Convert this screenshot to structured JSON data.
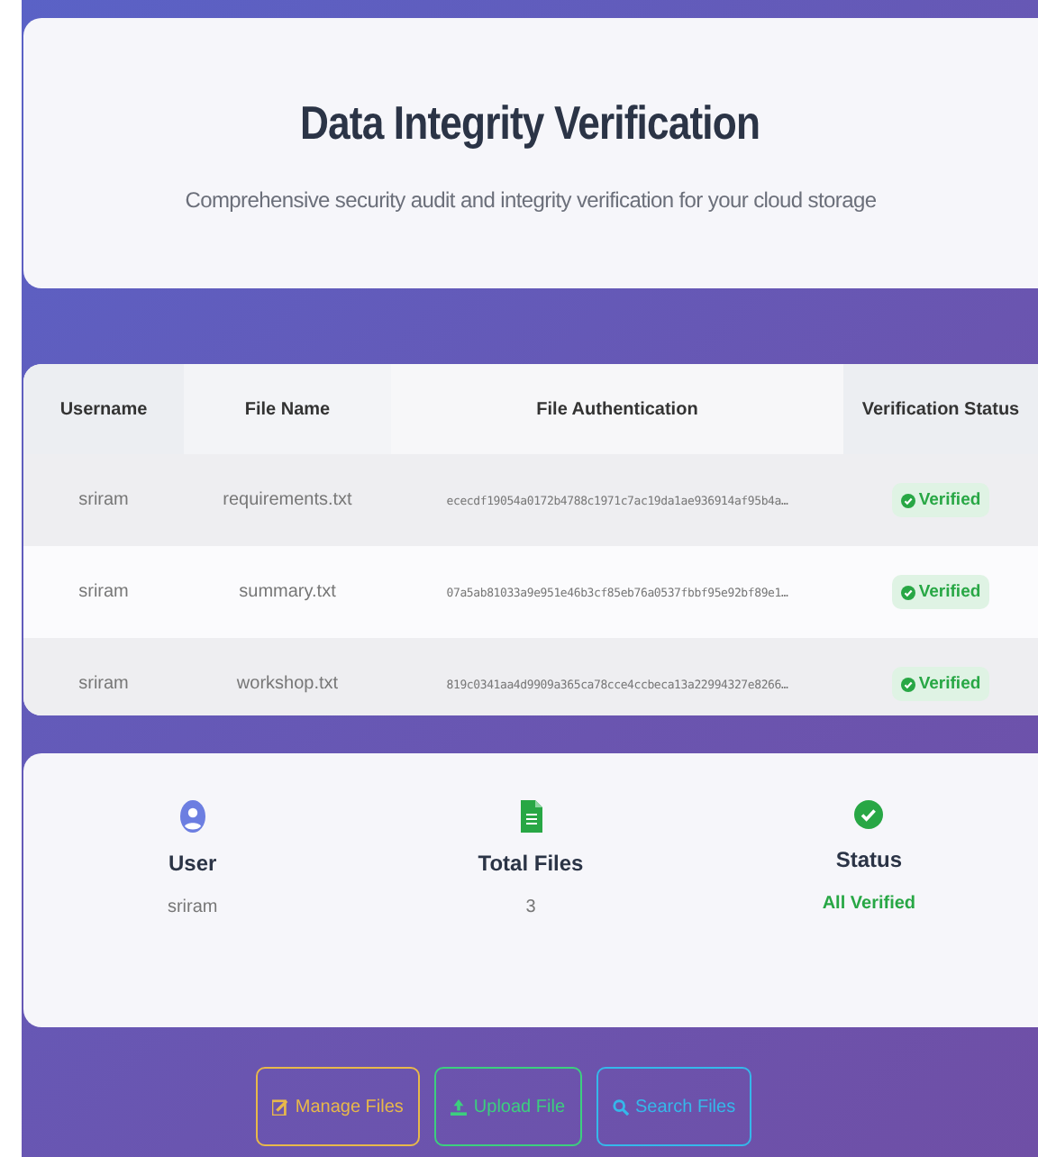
{
  "header": {
    "title": "Data Integrity Verification",
    "subtitle": "Comprehensive security audit and integrity verification for your cloud storage"
  },
  "table": {
    "columns": [
      "Username",
      "File Name",
      "File Authentication",
      "Verification Status"
    ],
    "rows": [
      {
        "username": "sriram",
        "file_name": "requirements.txt",
        "hash": "ececdf19054a0172b4788c1971c7ac19da1ae936914af95b4a…",
        "status": "Verified"
      },
      {
        "username": "sriram",
        "file_name": "summary.txt",
        "hash": "07a5ab81033a9e951e46b3cf85eb76a0537fbbf95e92bf89e1…",
        "status": "Verified"
      },
      {
        "username": "sriram",
        "file_name": "workshop.txt",
        "hash": "819c0341aa4d9909a365ca78cce4ccbeca13a22994327e8266…",
        "status": "Verified"
      }
    ]
  },
  "stats": [
    {
      "kind": "user",
      "label": "User",
      "value": "sriram"
    },
    {
      "kind": "files",
      "label": "Total Files",
      "value": "3"
    },
    {
      "kind": "status",
      "label": "Status",
      "value": "All Verified"
    }
  ],
  "buttons": [
    {
      "kind": "manage",
      "label": "Manage Files",
      "color": "#e8b84a"
    },
    {
      "kind": "upload",
      "label": "Upload File",
      "color": "#3ccf7e"
    },
    {
      "kind": "search",
      "label": "Search Files",
      "color": "#35b8ea"
    }
  ]
}
